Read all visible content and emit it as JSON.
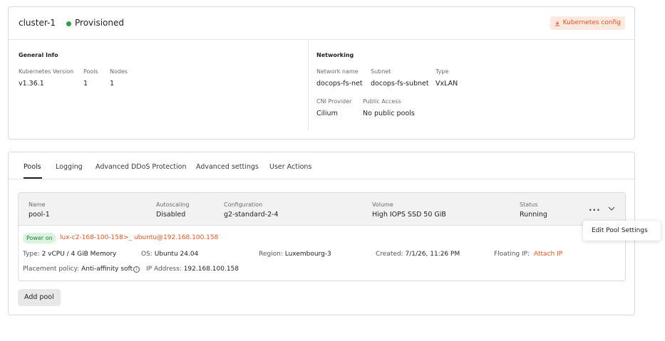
{
  "cluster": {
    "name": "cluster-1",
    "status": "Provisioned",
    "status_color": "#2ea043",
    "kube_config_label": "Kubernetes config",
    "kube_config_icon": "download-icon"
  },
  "general_info": {
    "title": "General Info",
    "kubernetes_version_label": "Kubernetes Version",
    "kubernetes_version": "v1.36.1",
    "pools_label": "Pools",
    "pools": "1",
    "nodes_label": "Nodes",
    "nodes": "1"
  },
  "networking": {
    "title": "Networking",
    "network_name_label": "Network name",
    "network_name": "docops-fs-net",
    "subnet_label": "Subnet",
    "subnet": "docops-fs-subnet",
    "type_label": "Type",
    "type": "VxLAN",
    "cni_label": "CNI Provider",
    "cni": "Cilium",
    "public_access_label": "Public Access",
    "public_access": "No public pools"
  },
  "tabs": [
    {
      "label": "Pools",
      "active": true
    },
    {
      "label": "Logging",
      "active": false
    },
    {
      "label": "Advanced DDoS Protection",
      "active": false
    },
    {
      "label": "Advanced settings",
      "active": false
    },
    {
      "label": "User Actions",
      "active": false
    }
  ],
  "pool": {
    "name_label": "Name",
    "name": "pool-1",
    "autoscaling_label": "Autoscaling",
    "autoscaling": "Disabled",
    "configuration_label": "Configuration",
    "configuration": "g2-standard-2-4",
    "volume_label": "Volume",
    "volume": "High IOPS SSD 50 GiB",
    "status_label": "Status",
    "status": "Running",
    "more_icon": "more-horizontal-icon",
    "expand_icon": "chevron-down-icon"
  },
  "node": {
    "power_state": "Power on",
    "hostname": "lux-c2-168-100-158",
    "terminal_icon": ">_",
    "ssh": "ubuntu@192.168.100.158",
    "type_label": "Type:",
    "type": "2 vCPU / 4 GiB Memory",
    "os_label": "OS:",
    "os": "Ubuntu 24.04",
    "region_label": "Region:",
    "region": "Luxembourg-3",
    "created_label": "Created:",
    "created": "7/1/26, 11:26 PM",
    "floating_ip_label": "Floating IP:",
    "attach_ip": "Attach IP",
    "placement_label": "Placement policy:",
    "placement": "Anti-affinity soft",
    "info_icon": "i",
    "ip_label": "IP Address:",
    "ip": "192.168.100.158"
  },
  "actions": {
    "add_pool": "Add pool"
  },
  "menu": {
    "edit_pool_settings": "Edit Pool Settings"
  },
  "colors": {
    "accent": "#e8541f",
    "accent_bg": "#fde9df",
    "success": "#2ea043",
    "success_bg": "#dcf3df"
  }
}
